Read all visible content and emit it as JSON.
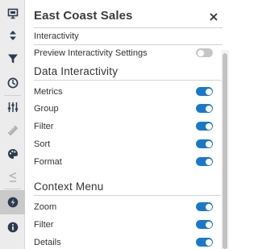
{
  "panel": {
    "title": "East Coast Sales",
    "interactivity_label": "Interactivity",
    "preview_label": "Preview Interactivity Settings",
    "preview_enabled": false
  },
  "data_interactivity": {
    "heading": "Data Interactivity",
    "items": [
      {
        "label": "Metrics",
        "enabled": true
      },
      {
        "label": "Group",
        "enabled": true
      },
      {
        "label": "Filter",
        "enabled": true
      },
      {
        "label": "Sort",
        "enabled": true
      },
      {
        "label": "Format",
        "enabled": true
      }
    ]
  },
  "context_menu": {
    "heading": "Context Menu",
    "items": [
      {
        "label": "Zoom",
        "enabled": true
      },
      {
        "label": "Filter",
        "enabled": true
      },
      {
        "label": "Details",
        "enabled": true
      }
    ]
  },
  "sidebar": {
    "icons": [
      "presentation-icon",
      "sort-arrows-icon",
      "filter-icon",
      "clock-icon",
      "sliders-icon",
      "ruler-icon",
      "palette-icon",
      "chevron-equal-icon",
      "lightning-icon",
      "info-icon"
    ],
    "active_icon": "lightning-icon"
  },
  "colors": {
    "accent": "#1b78c8",
    "toggle_off": "#c6c6c6",
    "sidebar_bg": "#ececec",
    "sidebar_active": "#c9c9c9",
    "icon": "#2b3a4f",
    "icon_disabled": "#b0b0b0"
  }
}
